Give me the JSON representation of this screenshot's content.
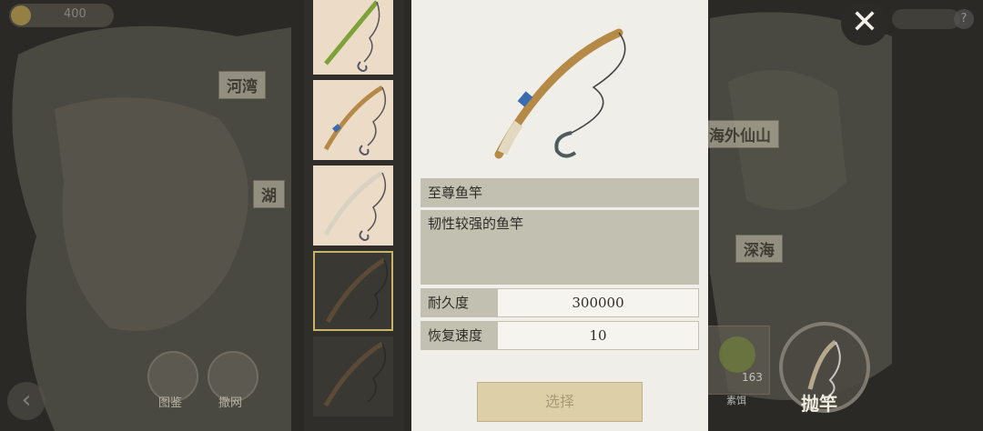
{
  "background": {
    "coin_amount": "400",
    "map_labels": [
      "河湾",
      "湖",
      "海外仙山",
      "深海"
    ],
    "buttons": [
      {
        "label": "图鉴",
        "icon": "book-icon"
      },
      {
        "label": "撒网",
        "icon": "net-icon"
      }
    ],
    "bait": {
      "count": "163",
      "label": "素饵"
    },
    "cast_label": "抛竿"
  },
  "rod_list": {
    "items": [
      {
        "name": "bamboo-rod",
        "locked": false,
        "selected": false
      },
      {
        "name": "supreme-rod",
        "locked": false,
        "selected": false
      },
      {
        "name": "white-rod",
        "locked": false,
        "selected": false
      },
      {
        "name": "locked-rod-1",
        "locked": true,
        "selected": true
      },
      {
        "name": "locked-rod-2",
        "locked": true,
        "selected": false
      }
    ]
  },
  "detail": {
    "name": "至尊鱼竿",
    "description": "韧性较强的鱼竿",
    "stats": [
      {
        "label": "耐久度",
        "value": "300000"
      },
      {
        "label": "恢复速度",
        "value": "10"
      }
    ],
    "select_label": "选择"
  },
  "colors": {
    "panel_bg": "#efeee9",
    "label_bg": "#c2c0b0",
    "rod_tile_bg": "#ecdcc7",
    "select_btn": "#ddd0a8"
  }
}
